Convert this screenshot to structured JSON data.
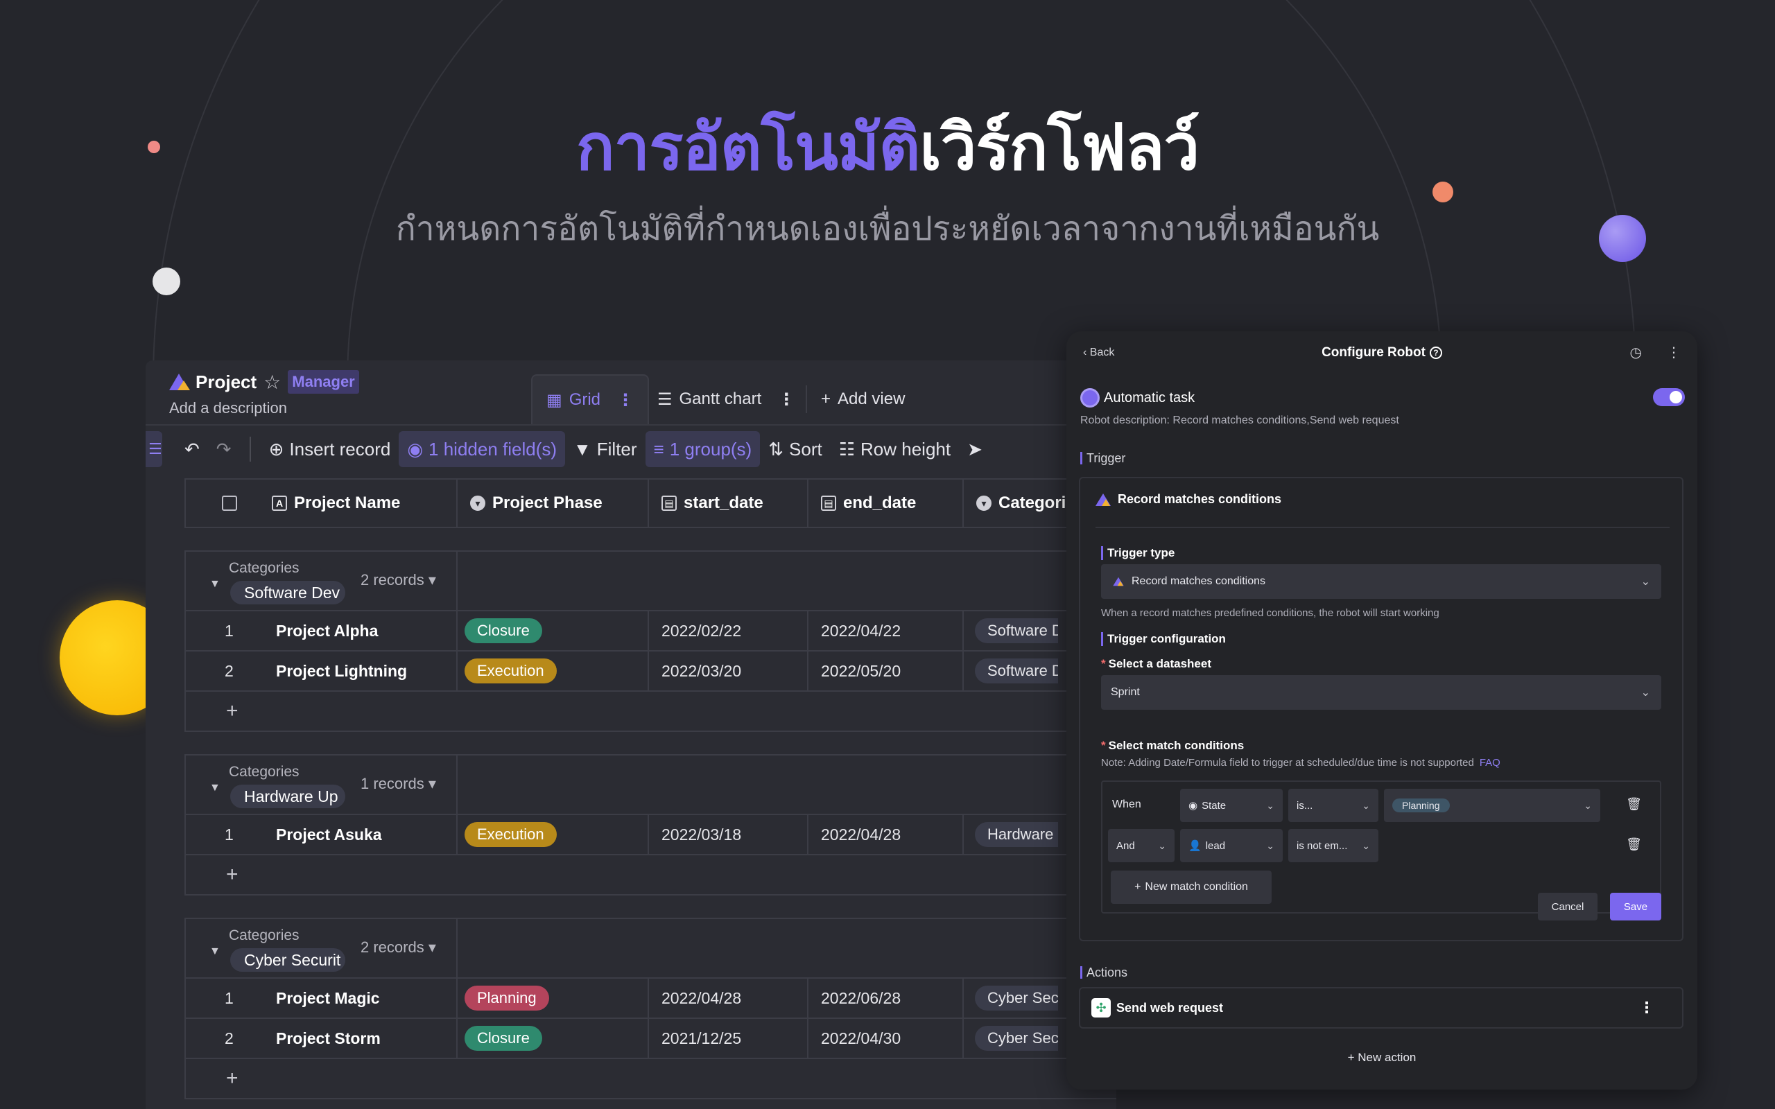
{
  "hero": {
    "title_accent": "การอัตโนมัติ",
    "title_rest": "เวิร์กโฟลว์",
    "subtitle": "กำหนดการอัตโนมัติที่กำหนดเองเพื่อประหยัดเวลาจากงานที่เหมือนกัน"
  },
  "sheet": {
    "title": "Project",
    "badge": "Manager",
    "description": "Add a description",
    "views": [
      {
        "label": "Grid",
        "icon": "grid-icon"
      },
      {
        "label": "Gantt chart",
        "icon": "gantt-icon"
      },
      {
        "label": "Add view",
        "icon": "plus-icon"
      }
    ],
    "toolbar": {
      "insert": "Insert record",
      "hidden": "1 hidden field(s)",
      "filter": "Filter",
      "group": "1 group(s)",
      "sort": "Sort",
      "row_height": "Row height"
    },
    "columns": [
      "Project Name",
      "Project Phase",
      "start_date",
      "end_date",
      "Categori"
    ],
    "group_label": "Categories",
    "groups": [
      {
        "value": "Software Dev",
        "count": "2 records ▾",
        "rows": [
          {
            "idx": "1",
            "name": "Project Alpha",
            "phase": "Closure",
            "start": "2022/02/22",
            "end": "2022/04/22",
            "cat": "Software De"
          },
          {
            "idx": "2",
            "name": "Project Lightning",
            "phase": "Execution",
            "start": "2022/03/20",
            "end": "2022/05/20",
            "cat": "Software De"
          }
        ]
      },
      {
        "value": "Hardware Up",
        "count": "1 records ▾",
        "rows": [
          {
            "idx": "1",
            "name": "Project Asuka",
            "phase": "Execution",
            "start": "2022/03/18",
            "end": "2022/04/28",
            "cat": "Hardware U"
          }
        ]
      },
      {
        "value": "Cyber Securit",
        "count": "2 records ▾",
        "rows": [
          {
            "idx": "1",
            "name": "Project Magic",
            "phase": "Planning",
            "start": "2022/04/28",
            "end": "2022/06/28",
            "cat": "Cyber Secu"
          },
          {
            "idx": "2",
            "name": "Project Storm",
            "phase": "Closure",
            "start": "2021/12/25",
            "end": "2022/04/30",
            "cat": "Cyber Secu"
          }
        ]
      }
    ],
    "phase_colors": {
      "Closure": "#2f8a6e",
      "Execution": "#b88a1a",
      "Planning": "#b4445c"
    }
  },
  "robot": {
    "back": "Back",
    "title": "Configure Robot",
    "name": "Automatic task",
    "description": "Robot description: Record matches conditions,Send web request",
    "trigger_section": "Trigger",
    "trigger_name": "Record matches conditions",
    "trigger_type_label": "Trigger type",
    "trigger_type_value": "Record matches conditions",
    "trigger_type_hint": "When a record matches predefined conditions, the robot will start working",
    "config_label": "Trigger configuration",
    "datasheet_label": "Select a datasheet",
    "datasheet_value": "Sprint",
    "match_label": "Select match conditions",
    "match_note": "Note: Adding Date/Formula field to trigger at scheduled/due time is not supported",
    "faq": "FAQ",
    "cond1": {
      "joiner": "When",
      "field": "State",
      "op": "is...",
      "value": "Planning"
    },
    "cond2": {
      "joiner": "And",
      "field": "lead",
      "op": "is not em..."
    },
    "new_condition": "New match condition",
    "cancel": "Cancel",
    "save": "Save",
    "actions_section": "Actions",
    "action_name": "Send web request",
    "new_action": "New action"
  },
  "colors": {
    "accent": "#7b67ee",
    "background": "#25262c"
  }
}
